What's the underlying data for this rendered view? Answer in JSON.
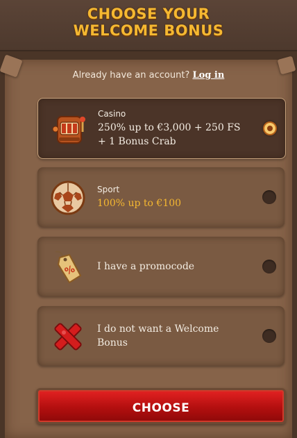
{
  "header": {
    "title_line1": "CHOOSE YOUR",
    "title_line2": "WELCOME BONUS"
  },
  "account": {
    "prompt": "Already have an account?",
    "login_label": "Log in"
  },
  "options": [
    {
      "category": "Casino",
      "description": "250% up to €3,000 + 250 FS + 1 Bonus Crab",
      "icon": "slot-machine-icon",
      "selected": true
    },
    {
      "category": "Sport",
      "description": "100% up to €100",
      "icon": "soccer-ball-icon",
      "selected": false
    },
    {
      "category": "",
      "description": "I have a promocode",
      "icon": "promo-tag-icon",
      "selected": false
    },
    {
      "category": "",
      "description": "I do not want a Welcome Bonus",
      "icon": "red-cross-icon",
      "selected": false
    }
  ],
  "action": {
    "choose_label": "CHOOSE"
  },
  "colors": {
    "gold": "#f5b831",
    "button_red": "#c81717",
    "panel": "#866349",
    "selected_card": "#4b3428"
  }
}
